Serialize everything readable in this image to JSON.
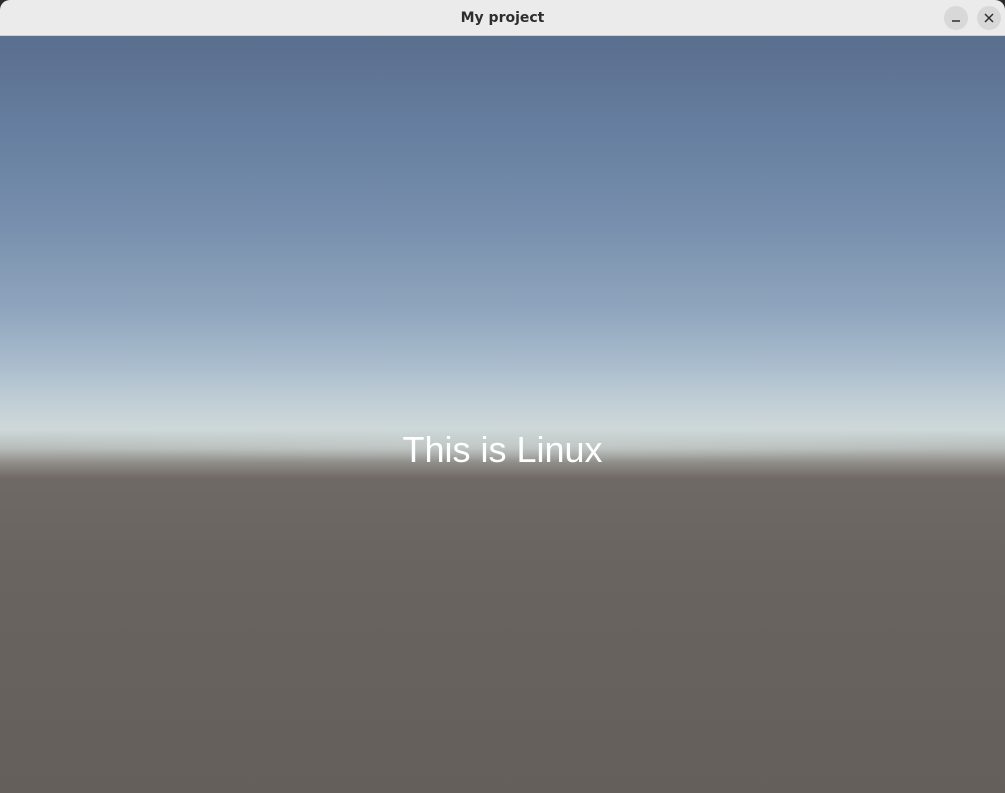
{
  "window": {
    "title": "My project"
  },
  "scene": {
    "caption": "This is Linux"
  },
  "icons": {
    "minimize": "minimize-icon",
    "close": "close-icon"
  },
  "colors": {
    "titlebar": "#ebebeb",
    "sky_top": "#5a6e8e",
    "horizon": "#ced8d8",
    "ground": "#655f5b",
    "caption_text": "#ffffff"
  }
}
